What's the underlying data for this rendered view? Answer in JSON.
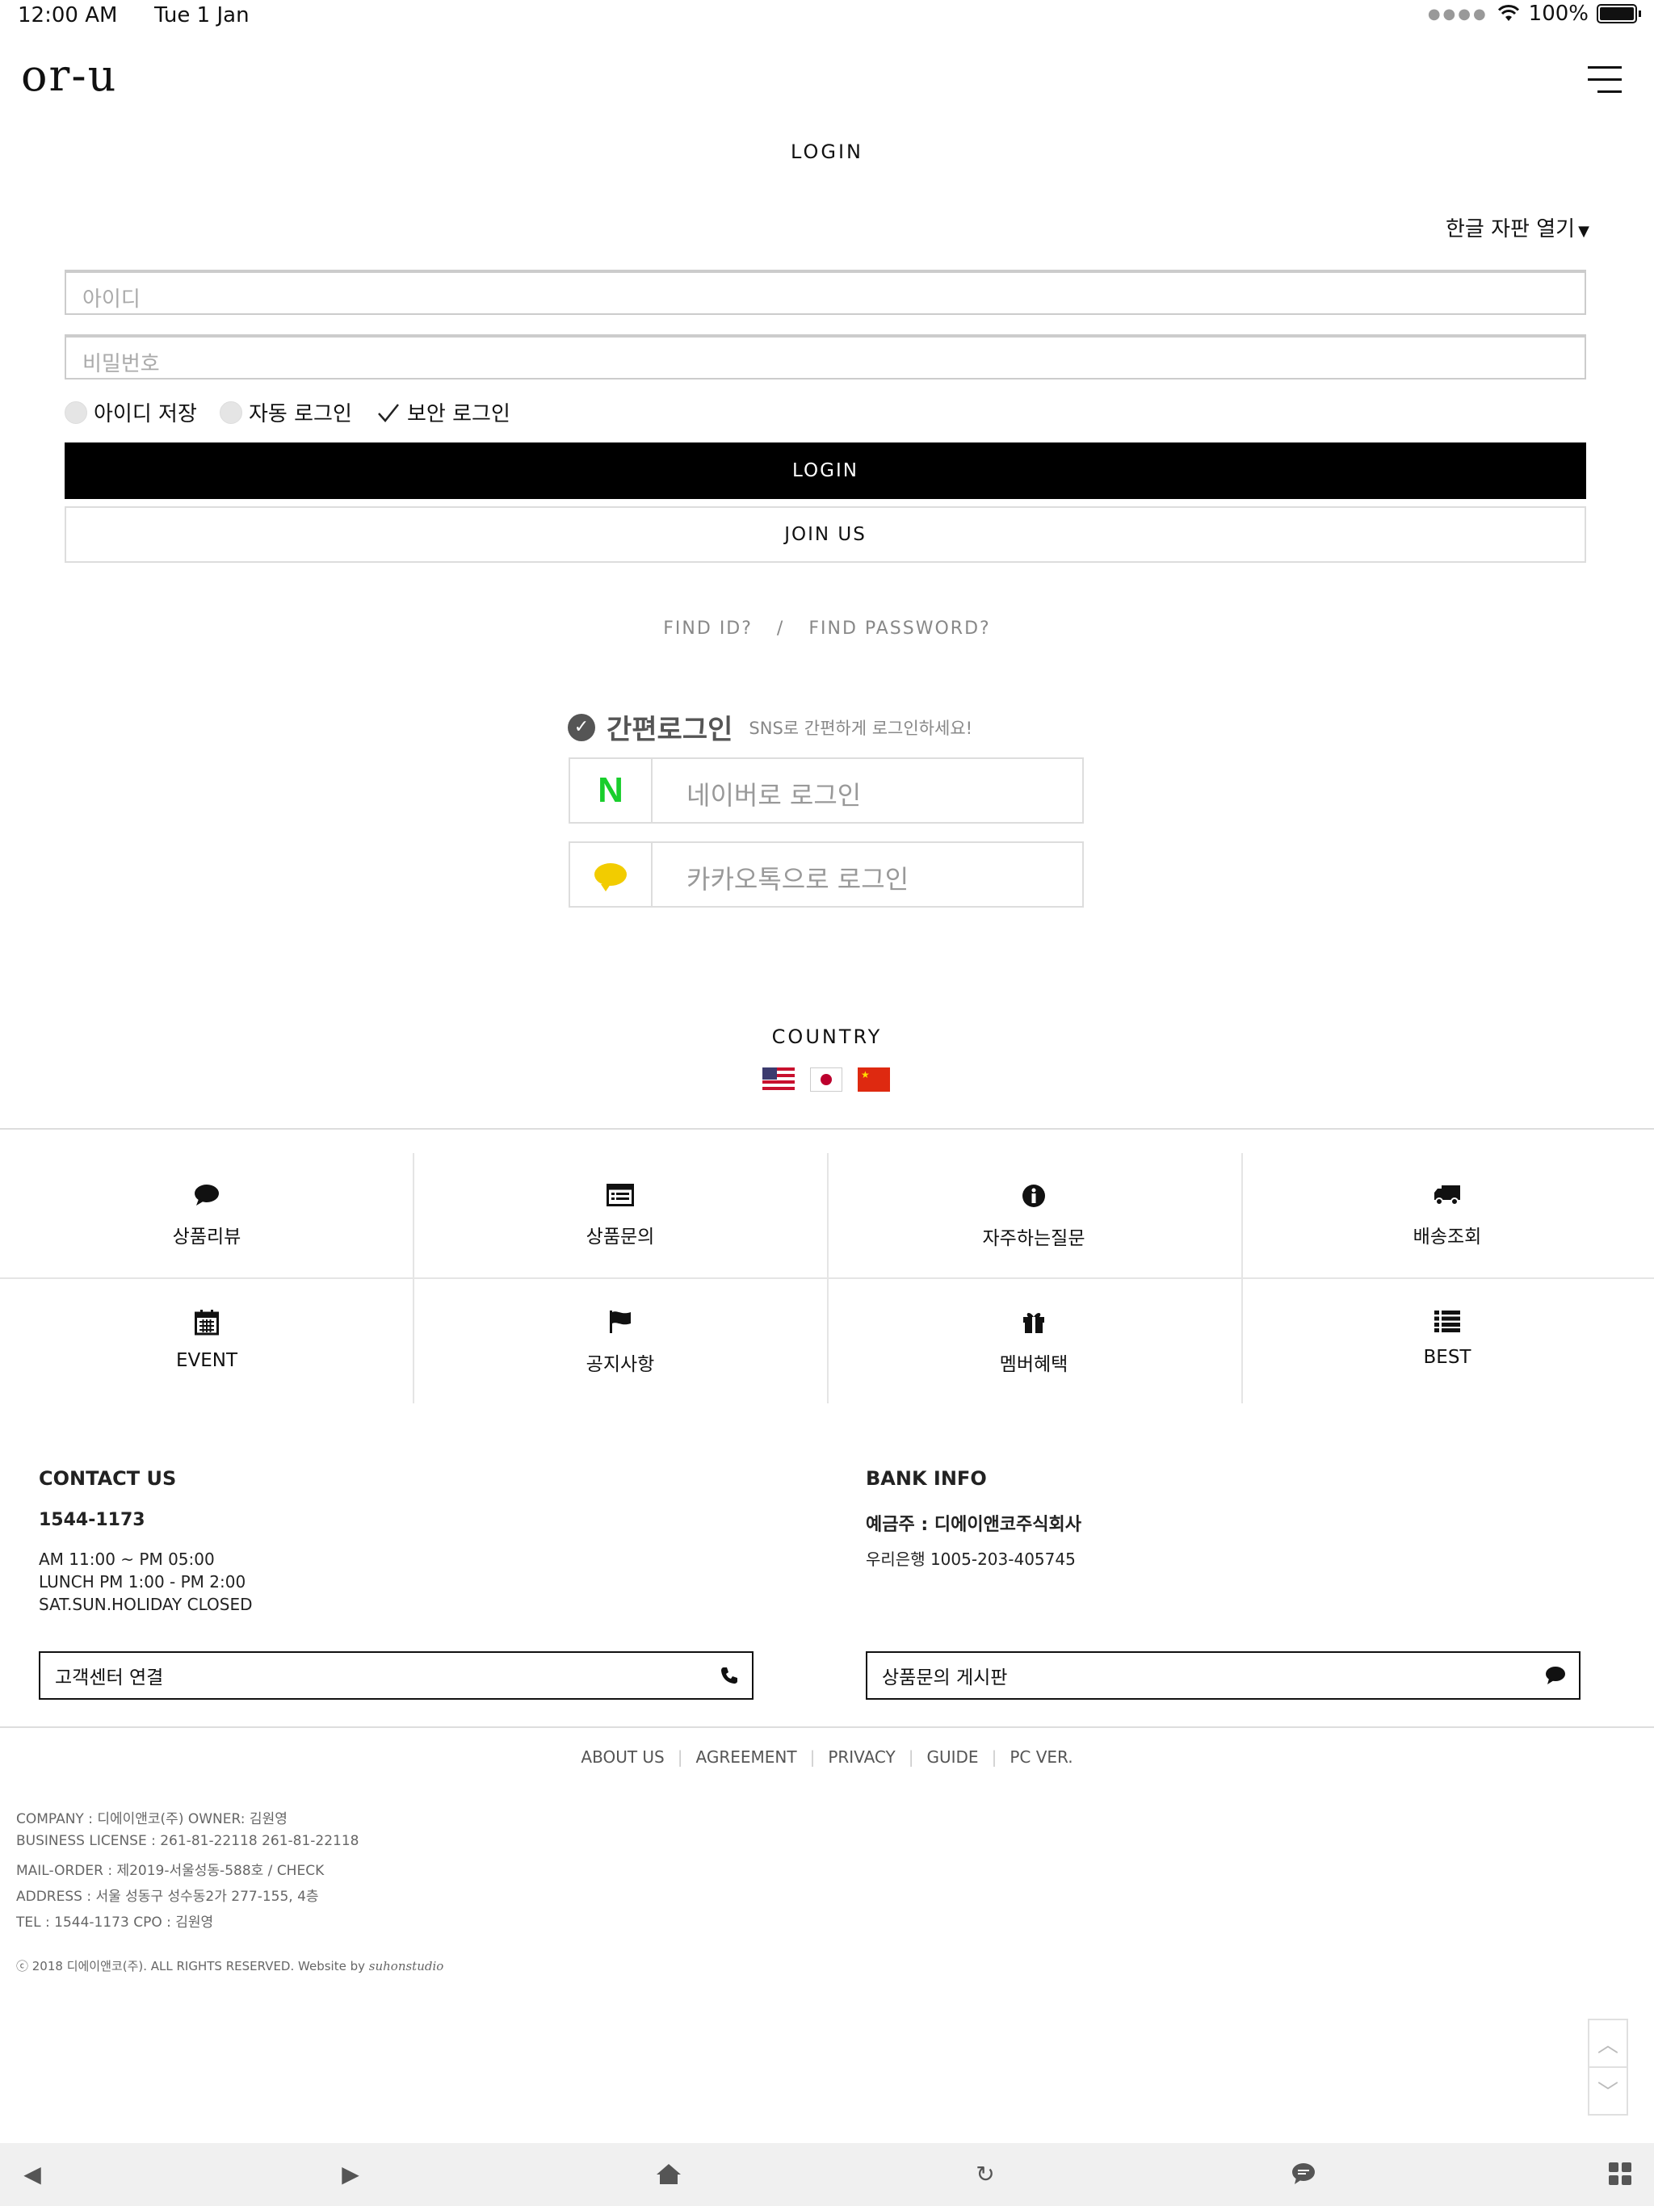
{
  "status_bar": {
    "time": "12:00 AM",
    "date": "Tue 1 Jan",
    "battery": "100%"
  },
  "header": {
    "logo": "or-u",
    "title": "LOGIN"
  },
  "login": {
    "keyboard_toggle": "한글 자판 열기",
    "userid_placeholder": "아이디",
    "password_placeholder": "비밀번호",
    "options": [
      "아이디 저장",
      "자동 로그인",
      "보안 로그인"
    ],
    "login_button": "LOGIN",
    "join_button": "JOIN US",
    "find_id": "FIND ID?",
    "separator": "/",
    "find_password": "FIND PASSWORD?"
  },
  "quick_login": {
    "title": "간편로그인",
    "subtitle": "SNS로 간편하게 로그인하세요!",
    "naver": "네이버로 로그인",
    "kakao": "카카오톡으로 로그인"
  },
  "country": {
    "title": "COUNTRY"
  },
  "quick_menu": [
    {
      "label": "상품리뷰",
      "icon": "comment-icon"
    },
    {
      "label": "상품문의",
      "icon": "list-alt-icon"
    },
    {
      "label": "자주하는질문",
      "icon": "info-icon"
    },
    {
      "label": "배송조회",
      "icon": "truck-icon"
    },
    {
      "label": "EVENT",
      "icon": "calendar-icon"
    },
    {
      "label": "공지사항",
      "icon": "flag-icon"
    },
    {
      "label": "멤버혜택",
      "icon": "gift-icon"
    },
    {
      "label": "BEST",
      "icon": "list-icon"
    }
  ],
  "contact": {
    "title": "CONTACT US",
    "phone": "1544-1173",
    "hours": "AM 11:00 ~ PM 05:00",
    "lunch": "LUNCH PM 1:00 - PM 2:00",
    "closed": "SAT.SUN.HOLIDAY CLOSED",
    "button": "고객센터 연결"
  },
  "bank": {
    "title": "BANK INFO",
    "holder": "예금주 : 디에이앤코주식회사",
    "account": "우리은행 1005-203-405745",
    "button": "상품문의 게시판"
  },
  "footer_links": [
    "ABOUT US",
    "AGREEMENT",
    "PRIVACY",
    "GUIDE",
    "PC VER."
  ],
  "business": {
    "line1": "COMPANY : 디에이앤코(주)     OWNER: 김원영",
    "line2": "BUSINESS LICENSE : 261-81-22118 261-81-22118",
    "line3": "MAIL-ORDER : 제2019-서울성동-588호 / CHECK",
    "line4": "ADDRESS : 서울 성동구 성수동2가 277-155, 4층",
    "line5": "TEL : 1544-1173     CPO : 김원영",
    "copyright": "ⓒ 2018 디에이앤코(주). ALL RIGHTS RESERVED. Website by",
    "credit": "suhonstudio"
  }
}
